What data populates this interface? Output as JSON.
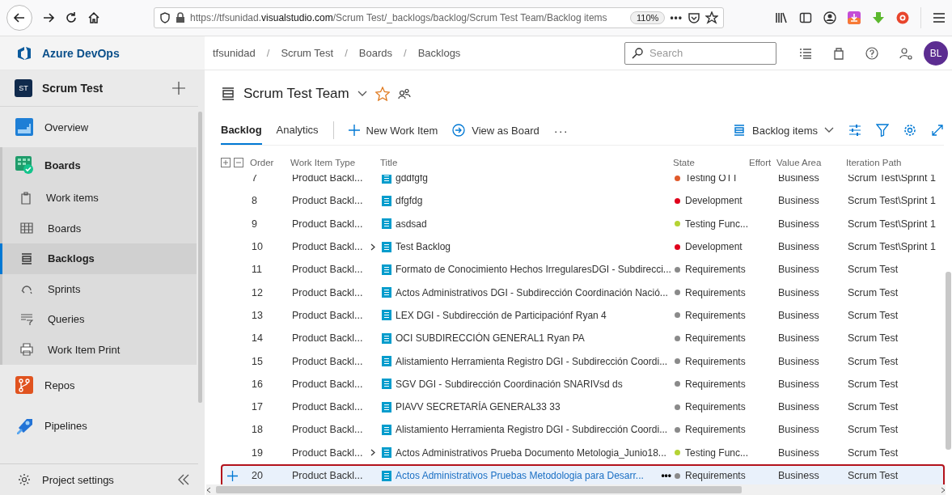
{
  "browser": {
    "url": {
      "prefix": "https://tfsunidad.",
      "domain": "visualstudio.com",
      "path": "/Scrum Test/_backlogs/backlog/Scrum Test Team/Backlog items"
    },
    "zoom": "110%",
    "more": "•••"
  },
  "header": {
    "product": "Azure DevOps",
    "breadcrumb": [
      {
        "kind": "link",
        "label": "tfsunidad"
      },
      {
        "kind": "separator",
        "label": "/"
      },
      {
        "kind": "link",
        "label": "Scrum Test"
      },
      {
        "kind": "separator",
        "label": "/"
      },
      {
        "kind": "link",
        "label": "Boards"
      },
      {
        "kind": "separator",
        "label": "/"
      },
      {
        "kind": "link",
        "label": "Backlogs"
      }
    ],
    "search": {
      "placeholder": "Search"
    },
    "avatar": "BL"
  },
  "project": {
    "badge": "ST",
    "name": "Scrum Test"
  },
  "nav": [
    {
      "label": "Overview",
      "expanded": false
    },
    {
      "label": "Boards",
      "expanded": true,
      "children": [
        {
          "label": "Work items",
          "selected": false
        },
        {
          "label": "Boards",
          "selected": false
        },
        {
          "label": "Backlogs",
          "selected": true
        },
        {
          "label": "Sprints",
          "selected": false
        },
        {
          "label": "Queries",
          "selected": false
        },
        {
          "label": "Work Item Print",
          "selected": false
        }
      ]
    },
    {
      "label": "Repos",
      "expanded": false
    },
    {
      "label": "Pipelines",
      "expanded": false
    }
  ],
  "settings": "Project settings",
  "team": {
    "title": "Scrum Test Team",
    "favorite": false
  },
  "tabs": [
    {
      "label": "Backlog",
      "selected": true
    },
    {
      "label": "Analytics",
      "selected": false
    }
  ],
  "actions": {
    "new_item": "New Work Item",
    "view_board": "View as Board",
    "more": "···",
    "level_picker": "Backlog items"
  },
  "table": {
    "columns": [
      "Order",
      "Work Item Type",
      "Title",
      "State",
      "Effort",
      "Value Area",
      "Iteration Path"
    ],
    "rows": [
      {
        "order": "7",
        "type": "Product Backl...",
        "expandable": false,
        "title": "gddfgfg",
        "state": "Testing OTT",
        "color": "#e05a2b",
        "value_area": "Business",
        "iteration": "Scrum Test\\Sprint 1",
        "selected": false,
        "outlined": false
      },
      {
        "order": "8",
        "type": "Product Backl...",
        "expandable": false,
        "title": "dfgfdg",
        "state": "Development",
        "color": "#e0001b",
        "value_area": "Business",
        "iteration": "Scrum Test\\Sprint 1",
        "selected": false,
        "outlined": false
      },
      {
        "order": "9",
        "type": "Product Backl...",
        "expandable": false,
        "title": "asdsad",
        "state": "Testing Func...",
        "color": "#b5d334",
        "value_area": "Business",
        "iteration": "Scrum Test\\Sprint 1",
        "selected": false,
        "outlined": false
      },
      {
        "order": "10",
        "type": "Product Backl...",
        "expandable": true,
        "title": "Test Backlog",
        "state": "Development",
        "color": "#e0001b",
        "value_area": "Business",
        "iteration": "Scrum Test\\Sprint 1",
        "selected": false,
        "outlined": false
      },
      {
        "order": "11",
        "type": "Product Backl...",
        "expandable": false,
        "title": "Formato de Conocimiento Hechos IrregularesDGI - Subdirecci...",
        "state": "Requirements",
        "color": "#8a8a8a",
        "value_area": "Business",
        "iteration": "Scrum Test",
        "selected": false,
        "outlined": false
      },
      {
        "order": "12",
        "type": "Product Backl...",
        "expandable": false,
        "title": "Actos Administrativos DGI - Subdirección Coordinación Nació...",
        "state": "Requirements",
        "color": "#8a8a8a",
        "value_area": "Business",
        "iteration": "Scrum Test",
        "selected": false,
        "outlined": false
      },
      {
        "order": "13",
        "type": "Product Backl...",
        "expandable": false,
        "title": "LEX DGI - Subdirección de Participaciónf Ryan 4",
        "state": "Requirements",
        "color": "#8a8a8a",
        "value_area": "Business",
        "iteration": "Scrum Test",
        "selected": false,
        "outlined": false
      },
      {
        "order": "14",
        "type": "Product Backl...",
        "expandable": false,
        "title": "OCI SUBDIRECCIÓN GENERAL1 Ryan PA",
        "state": "Requirements",
        "color": "#8a8a8a",
        "value_area": "Business",
        "iteration": "Scrum Test",
        "selected": false,
        "outlined": false
      },
      {
        "order": "15",
        "type": "Product Backl...",
        "expandable": false,
        "title": "Alistamiento Herramienta Registro DGI - Subdirección Coordi...",
        "state": "Requirements",
        "color": "#8a8a8a",
        "value_area": "Business",
        "iteration": "Scrum Test",
        "selected": false,
        "outlined": false
      },
      {
        "order": "16",
        "type": "Product Backl...",
        "expandable": false,
        "title": "SGV DGI - Subdirección Coordinación SNARIVsd ds",
        "state": "Requirements",
        "color": "#8a8a8a",
        "value_area": "Business",
        "iteration": "Scrum Test",
        "selected": false,
        "outlined": false
      },
      {
        "order": "17",
        "type": "Product Backl...",
        "expandable": false,
        "title": "PIAVV SECRETARÍA GENERAL33 33",
        "state": "Requirements",
        "color": "#8a8a8a",
        "value_area": "Business",
        "iteration": "Scrum Test",
        "selected": false,
        "outlined": false
      },
      {
        "order": "18",
        "type": "Product Backl...",
        "expandable": false,
        "title": "Alistamiento Herramienta Registro DGI - Subdirección Coordi...",
        "state": "Requirements",
        "color": "#8a8a8a",
        "value_area": "Business",
        "iteration": "Scrum Test",
        "selected": false,
        "outlined": false
      },
      {
        "order": "19",
        "type": "Product Backl...",
        "expandable": true,
        "title": "Actos Administrativos Prueba Documento Metologia_Junio18...",
        "state": "Testing Func...",
        "color": "#b5d334",
        "value_area": "Business",
        "iteration": "Scrum Test",
        "selected": false,
        "outlined": false
      },
      {
        "order": "20",
        "type": "Product Backl...",
        "expandable": false,
        "title": "Actos Administrativos Pruebas Metodologia para Desarr...",
        "state": "Requirements",
        "color": "#8a8a8a",
        "value_area": "Business",
        "iteration": "Scrum Test",
        "selected": true,
        "outlined": true
      }
    ]
  }
}
